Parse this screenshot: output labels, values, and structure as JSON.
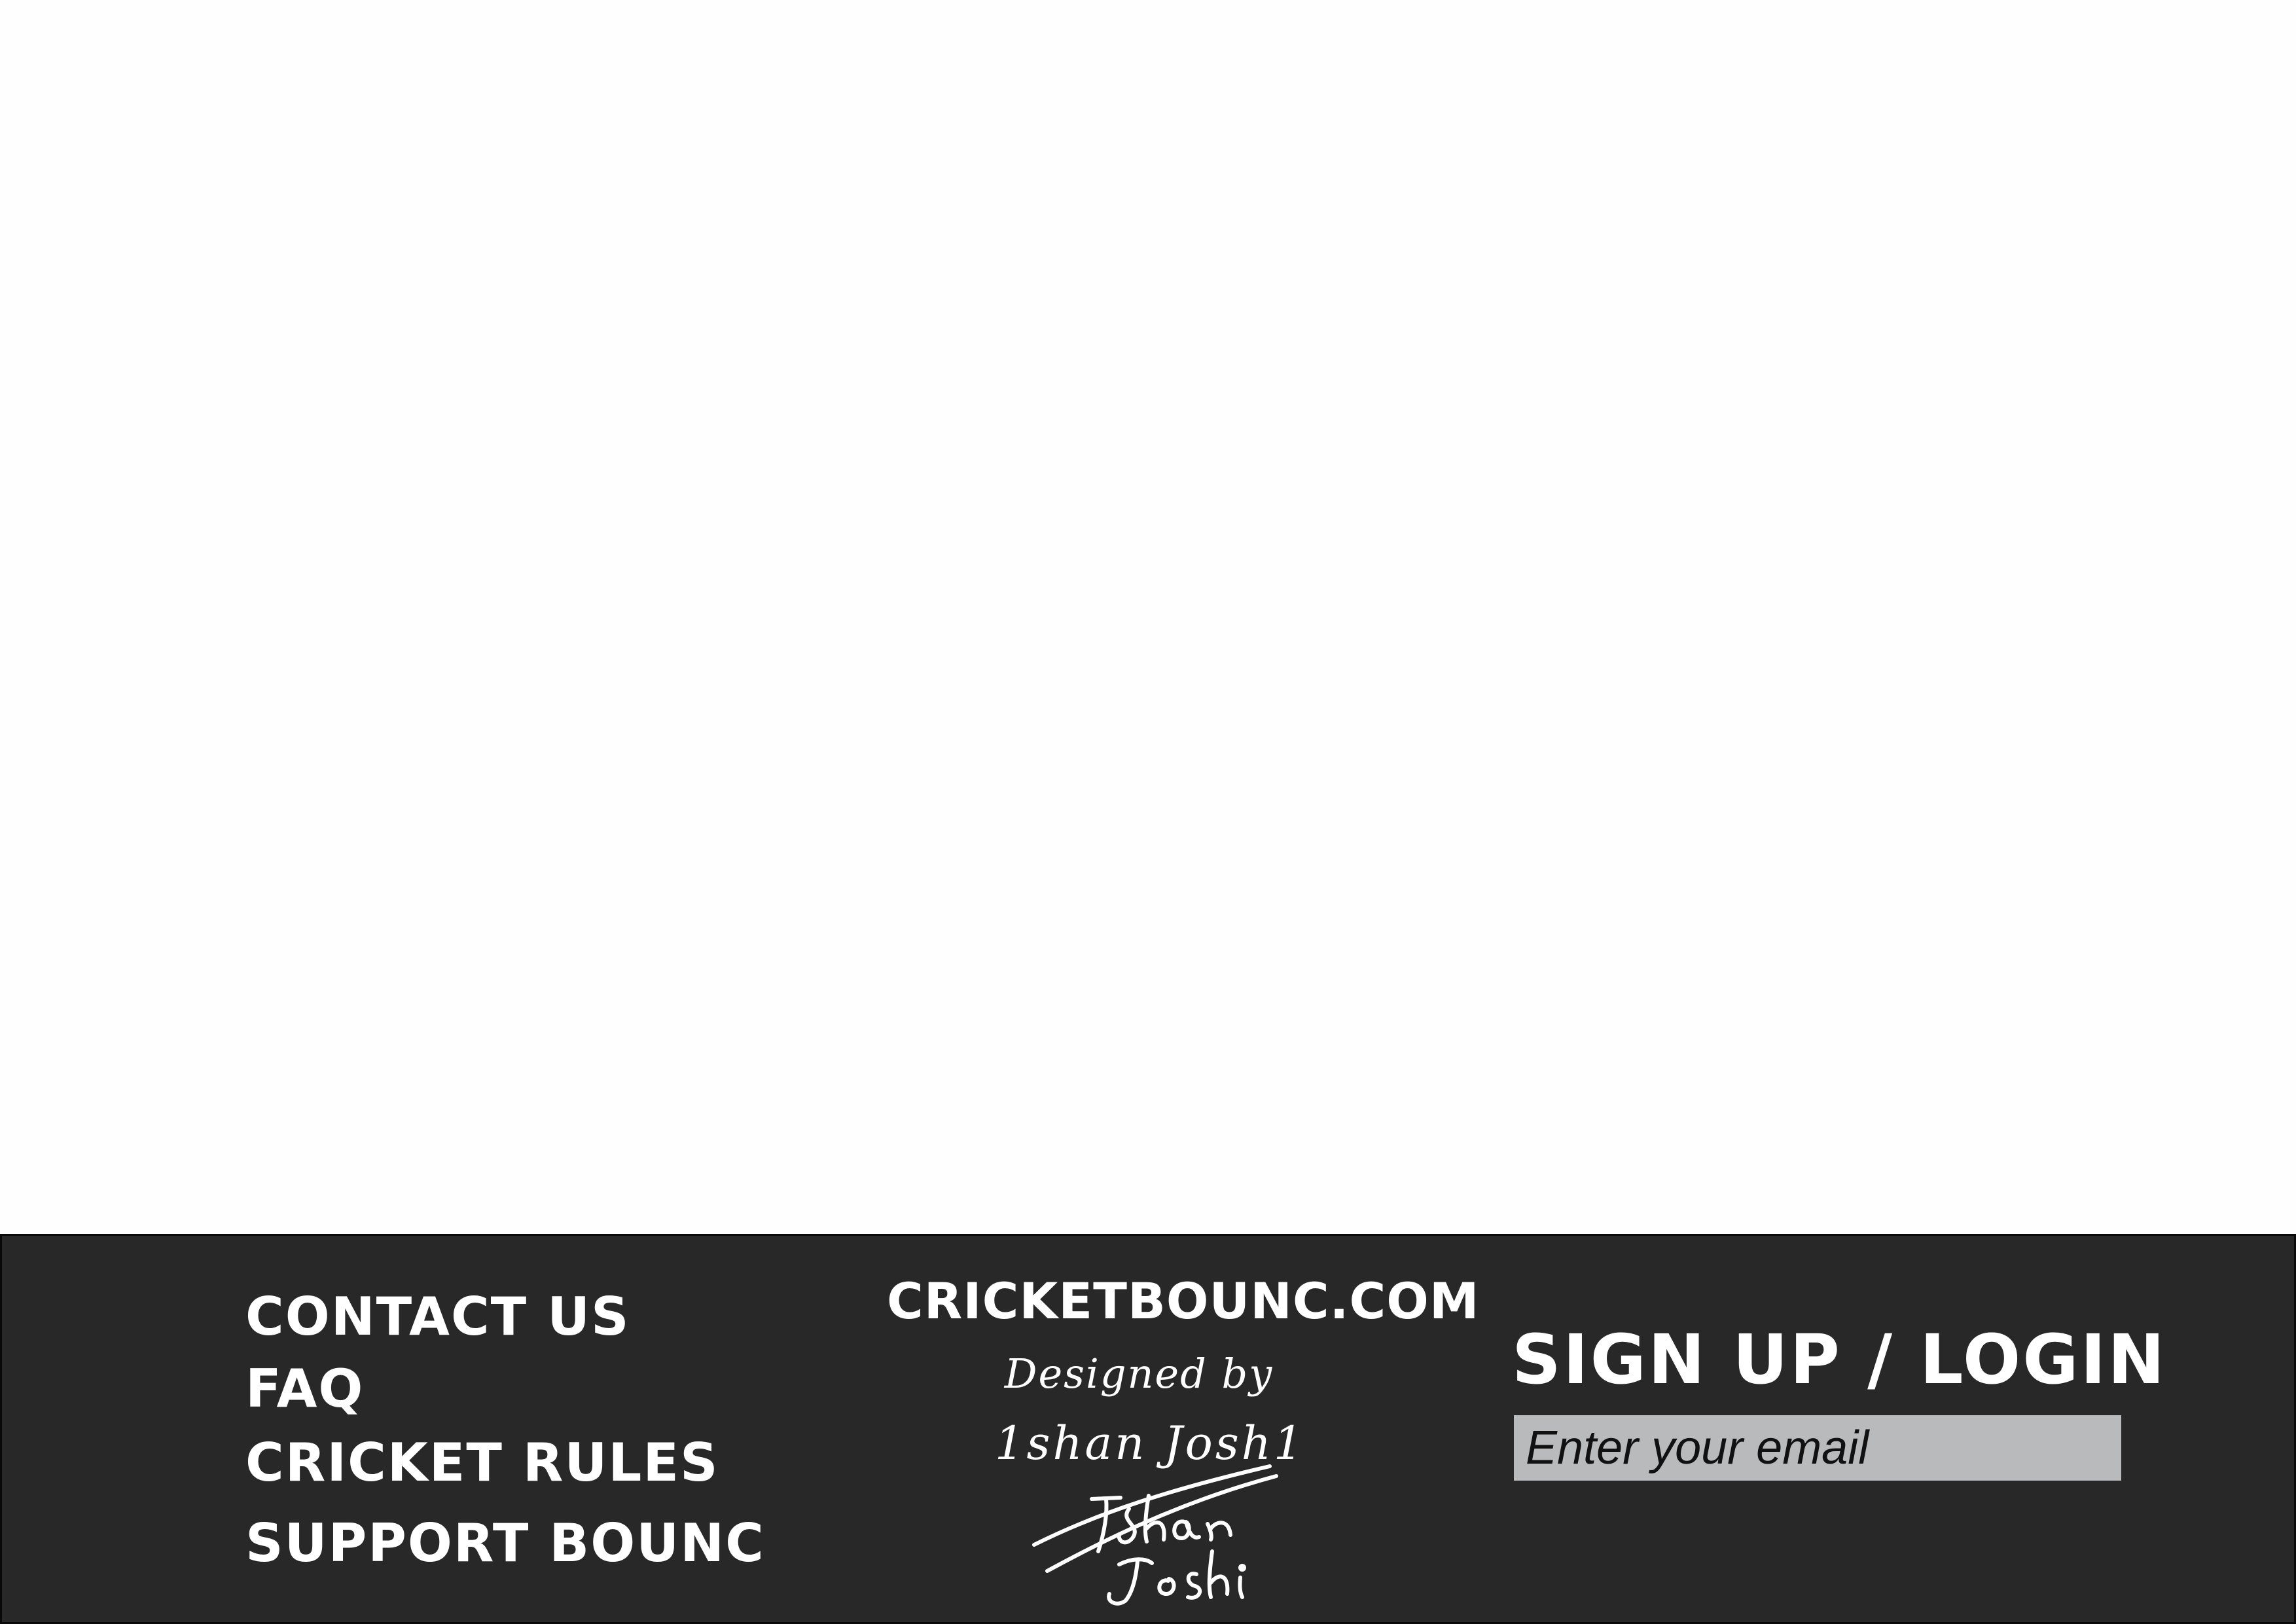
{
  "footer": {
    "links": [
      {
        "label": "CONTACT US"
      },
      {
        "label": "FAQ"
      },
      {
        "label": "CRICKET RULES"
      },
      {
        "label": "SUPPORT BOUNC"
      }
    ],
    "site_name": "CRICKETBOUNC.COM",
    "credit_line_1": "Designed by",
    "credit_line_2": "1shan Josh1",
    "signature_text": "Ishan Joshi",
    "signup": {
      "title": "SIGN UP / LOGIN",
      "email_placeholder": "Enter your email"
    },
    "colors": {
      "background": "#282828",
      "text": "#ffffff",
      "input_background": "#b9babc"
    }
  }
}
